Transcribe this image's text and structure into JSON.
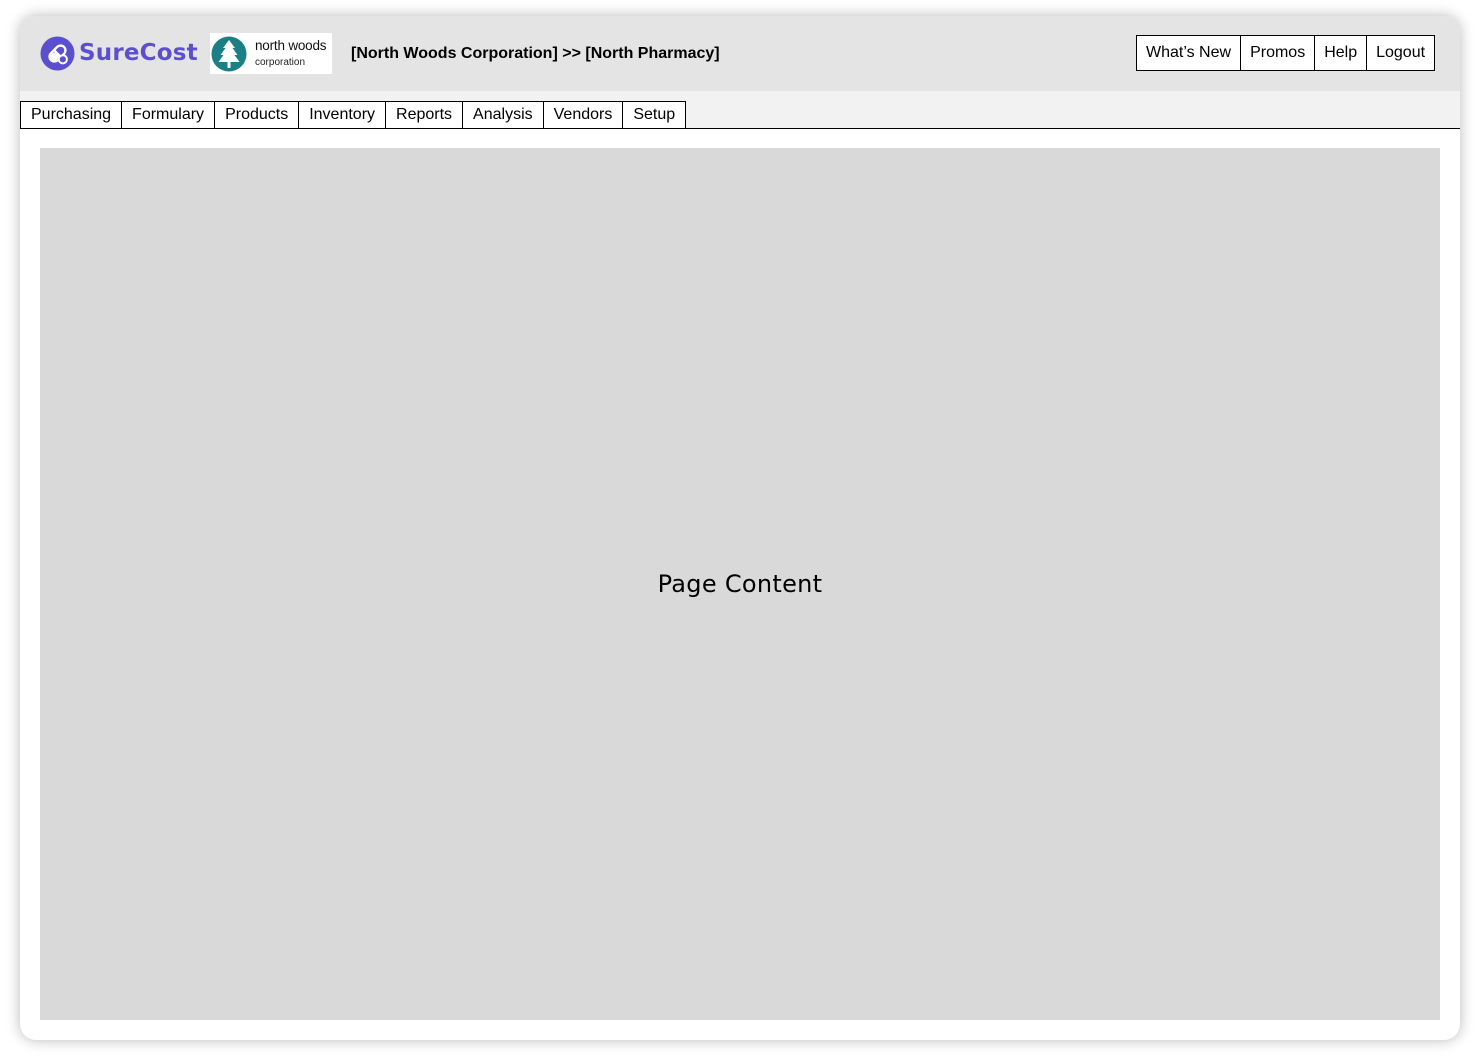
{
  "brand": {
    "name": "SureCost",
    "icon": "pill-capsule-icon",
    "color": "#5b4fd0"
  },
  "client": {
    "name": "north woods",
    "subtitle": "corporation",
    "icon": "pine-tree-icon",
    "color": "#1b7f86"
  },
  "breadcrumb": "[North Woods Corporation] >> [North Pharmacy]",
  "top_links": [
    {
      "label": "What’s New"
    },
    {
      "label": "Promos"
    },
    {
      "label": "Help"
    },
    {
      "label": "Logout"
    }
  ],
  "tabs": [
    {
      "label": "Purchasing"
    },
    {
      "label": "Formulary"
    },
    {
      "label": "Products"
    },
    {
      "label": "Inventory"
    },
    {
      "label": "Reports"
    },
    {
      "label": "Analysis"
    },
    {
      "label": "Vendors"
    },
    {
      "label": "Setup"
    }
  ],
  "main": {
    "placeholder": "Page Content"
  }
}
